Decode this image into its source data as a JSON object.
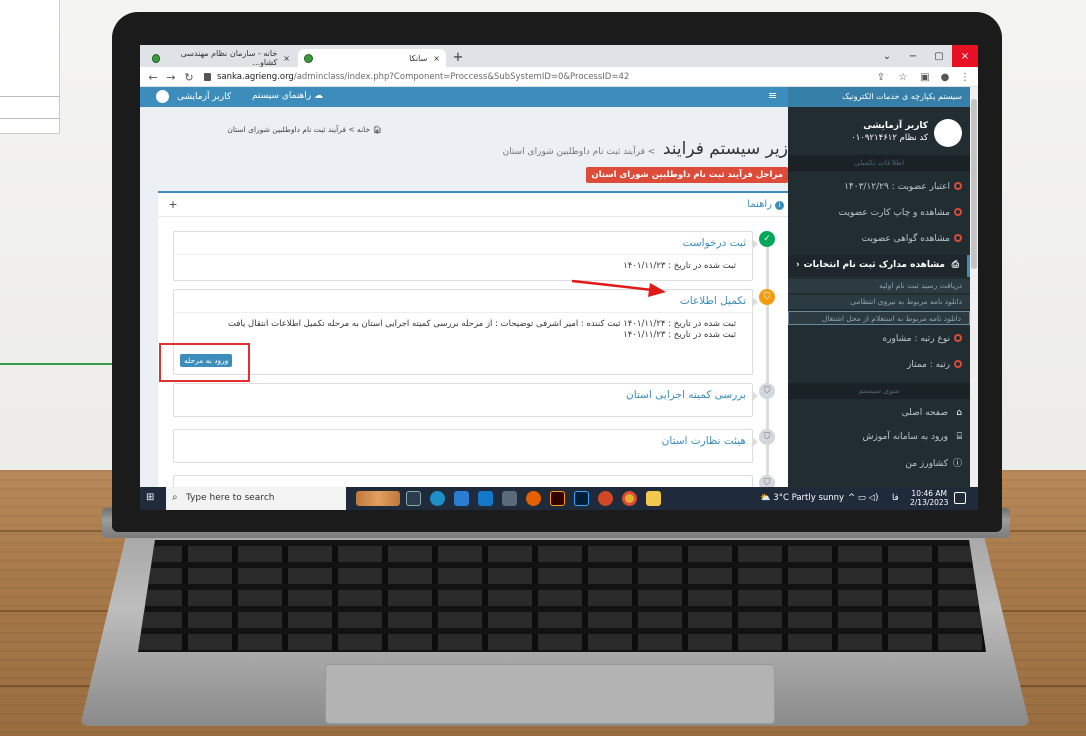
{
  "browser": {
    "tabs": [
      {
        "label": "خانه - سازمان نظام مهندسی کشاو...",
        "close": "×"
      },
      {
        "label": "سانکا",
        "close": "×"
      }
    ],
    "new_tab": "+",
    "url_host": "sanka.agrieng.org",
    "url_path": "/adminclass/index.php?Component=Proccess&SubSystemID=0&ProcessID=42",
    "window_controls": [
      "⌄",
      "−",
      "▢",
      "×"
    ]
  },
  "header": {
    "user_label": "کاربر آزمایشی",
    "guide_label": "راهنمای سیستم",
    "menu_icon": "≡",
    "sidebar_title": "سیستم یکپارچه ی خدمات الکترونیک"
  },
  "breadcrumb": {
    "home": "خانه",
    "separator": ">",
    "current": "فرآیند ثبت نام داوطلبین شورای استان"
  },
  "page": {
    "title": "زیر سیستم فرایند",
    "subtitle": "> فرآیند ثبت نام داوطلبین شورای استان",
    "red_label": "مراحل فرآیند ثبت نام داوطلبین شورای استان"
  },
  "box": {
    "title": "راهنما",
    "plus": "+"
  },
  "timeline": [
    {
      "title": "ثبت درخواست",
      "status": "done",
      "lines": [
        "ثبت شده در تاریخ : ۱۴۰۱/۱۱/۲۳"
      ]
    },
    {
      "title": "تکمیل اطلاعات",
      "status": "current",
      "lines": [
        "ثبت شده در تاریخ : ۱۴۰۱/۱۱/۲۴ ثبت کننده : امیر اشرفی توضیحات : از مرحله بررسی کمیته اجرایی استان به مرحله تکمیل اطلاعات انتقال یافت",
        "ثبت شده در تاریخ : ۱۴۰۱/۱۱/۲۳"
      ],
      "button": "ورود به مرحله"
    },
    {
      "title": "بررسی کمیته اجرایی استان",
      "status": "pending",
      "lines": []
    },
    {
      "title": "هیئت نظارت استان",
      "status": "pending",
      "lines": []
    }
  ],
  "sidebar": {
    "name": "کاربر آزمایشی",
    "code": "کد نظام ۰۱۰۹۲۱۴۶۱۲",
    "section1": "اطلاعات تکمیلی",
    "items": [
      "اعتبار عضویت : ۱۴۰۳/۱۲/۲۹",
      "مشاهده و چاپ کارت عضویت",
      "مشاهده گواهی عضویت",
      "مشاهده مدارک ثبت نام انتخابات"
    ],
    "subitems": [
      "دریافت رسید ثبت نام اولیه",
      "دانلود نامه مربوط به نیروی انتظامی",
      "دانلود نامه مربوط به استعلام از محل اشتغال"
    ],
    "items2": [
      "نوع رتبه : مشاوره",
      "رتبه : ممتاز"
    ],
    "section2": "منوی سیستم",
    "menu": [
      "صفحه اصلی",
      "ورود به سامانه آموزش",
      "کشاورز من"
    ]
  },
  "taskbar": {
    "search_placeholder": "Type here to search",
    "weather": "3°C  Partly sunny",
    "lang": "فا",
    "time": "10:46 AM",
    "date": "2/13/2023"
  },
  "colors": {
    "header_blue": "#3c8dbc",
    "sidebar_dark": "#222d32",
    "red_label": "#dd4b39",
    "done_green": "#00a65a",
    "current_orange": "#f39c12"
  }
}
